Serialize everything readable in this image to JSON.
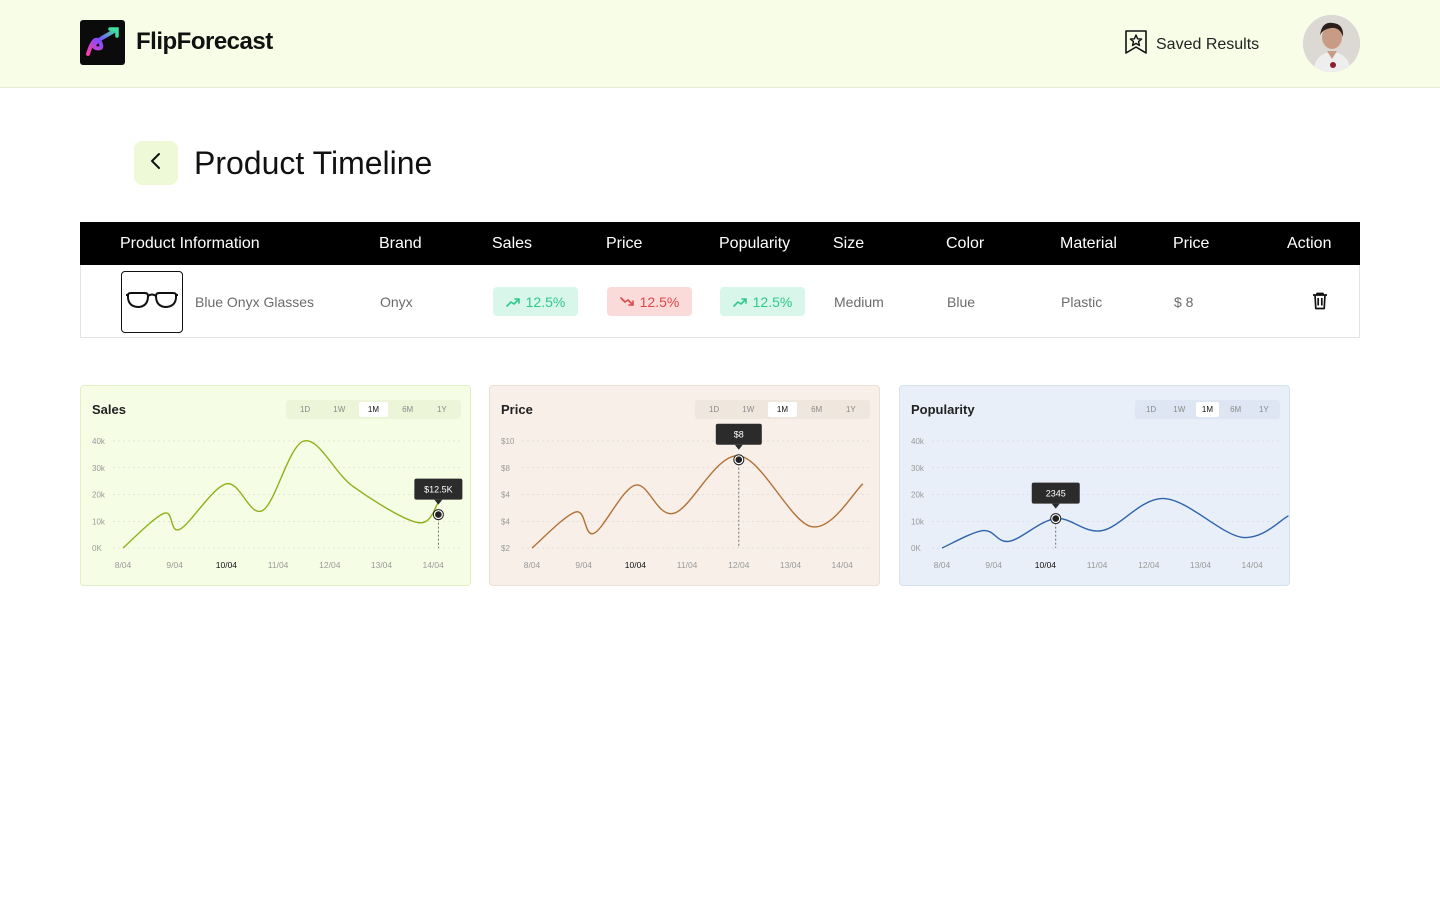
{
  "app": {
    "name": "FlipForecast"
  },
  "header": {
    "saved_label": "Saved Results"
  },
  "page": {
    "title": "Product Timeline"
  },
  "table": {
    "headers": [
      "Product Information",
      "Brand",
      "Sales",
      "Price",
      "Popularity",
      "Size",
      "Color",
      "Material",
      "Price",
      "Action"
    ],
    "row": {
      "name": "Blue Onyx Glasses",
      "brand": "Onyx",
      "sales": "12.5%",
      "price_change": "12.5%",
      "popularity": "12.5%",
      "size": "Medium",
      "color": "Blue",
      "material": "Plastic",
      "price": "$ 8"
    }
  },
  "ranges": [
    "1D",
    "1W",
    "1M",
    "6M",
    "1Y"
  ],
  "active_range": "1M",
  "chart_data": [
    {
      "type": "line",
      "title": "Sales",
      "color": "#8fb01c",
      "y_ticks": [
        "40k",
        "30k",
        "20k",
        "10k",
        "0K"
      ],
      "ylim": [
        0,
        40000
      ],
      "x_ticks": [
        "8/04",
        "9/04",
        "10/04",
        "11/04",
        "12/04",
        "13/04",
        "14/04"
      ],
      "highlight_tick": "10/04",
      "x": [
        0,
        0.8,
        1.1,
        2.0,
        2.7,
        3.5,
        4.45,
        5.7,
        6.1
      ],
      "values": [
        0,
        13000,
        7000,
        24000,
        14000,
        40000,
        23000,
        9500,
        17000
      ],
      "marker_x": 6.1,
      "marker_value": 12500,
      "marker_label": "$12.5K"
    },
    {
      "type": "line",
      "title": "Price",
      "color": "#b27135",
      "y_ticks": [
        "$10",
        "$8",
        "$4",
        "$4",
        "$2"
      ],
      "ylim": [
        2,
        10
      ],
      "x_ticks": [
        "8/04",
        "9/04",
        "10/04",
        "11/04",
        "12/04",
        "13/04",
        "14/04"
      ],
      "highlight_tick": "10/04",
      "x": [
        0,
        0.85,
        1.2,
        2.0,
        2.75,
        4.0,
        5.4,
        6.4
      ],
      "values": [
        2,
        4.7,
        3.1,
        6.7,
        4.6,
        8.9,
        3.6,
        6.8
      ],
      "marker_x": 4.0,
      "marker_value": 8.6,
      "marker_label": "$8"
    },
    {
      "type": "line",
      "title": "Popularity",
      "color": "#2e64ad",
      "y_ticks": [
        "40k",
        "30k",
        "20k",
        "10k",
        "0K"
      ],
      "ylim": [
        0,
        40000
      ],
      "x_ticks": [
        "8/04",
        "9/04",
        "10/04",
        "11/04",
        "12/04",
        "13/04",
        "14/04"
      ],
      "highlight_tick": "10/04",
      "x": [
        0,
        0.8,
        1.3,
        2.2,
        3.1,
        4.3,
        5.8,
        6.7
      ],
      "values": [
        0,
        6500,
        2500,
        11000,
        6500,
        18500,
        4000,
        12000
      ],
      "marker_x": 2.2,
      "marker_value": 11000,
      "marker_label": "2345"
    }
  ]
}
